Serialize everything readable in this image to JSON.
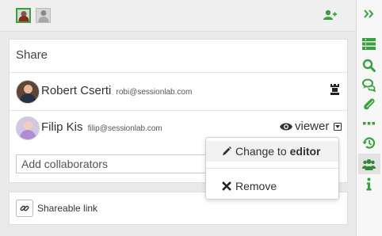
{
  "colors": {
    "accent_green": "#33a33a",
    "text_dark": "#333333"
  },
  "topbar": {
    "avatars": [
      {
        "icon": "user-avatar",
        "active": true
      },
      {
        "icon": "user-avatar",
        "active": false
      }
    ],
    "add_icon": "add-person-icon"
  },
  "share": {
    "title": "Share",
    "users": [
      {
        "name": "Robert Cserti",
        "email": "robi@sessionlab.com",
        "role_icon": "rook-owner-icon"
      },
      {
        "name": "Filip Kis",
        "email": "filip@sessionlab.com",
        "role": "viewer",
        "role_icon": "eye-icon"
      }
    ],
    "collab_placeholder": "Add collaborators"
  },
  "dropdown": {
    "change_prefix": "Change to",
    "change_role": "editor",
    "remove_label": "Remove"
  },
  "link": {
    "label": "Shareable link"
  },
  "rail": {
    "icons": [
      "expand-icon",
      "list-icon",
      "search-icon",
      "comments-icon",
      "attachment-icon",
      "more-icon",
      "history-icon",
      "collaborators-icon",
      "info-icon"
    ]
  }
}
